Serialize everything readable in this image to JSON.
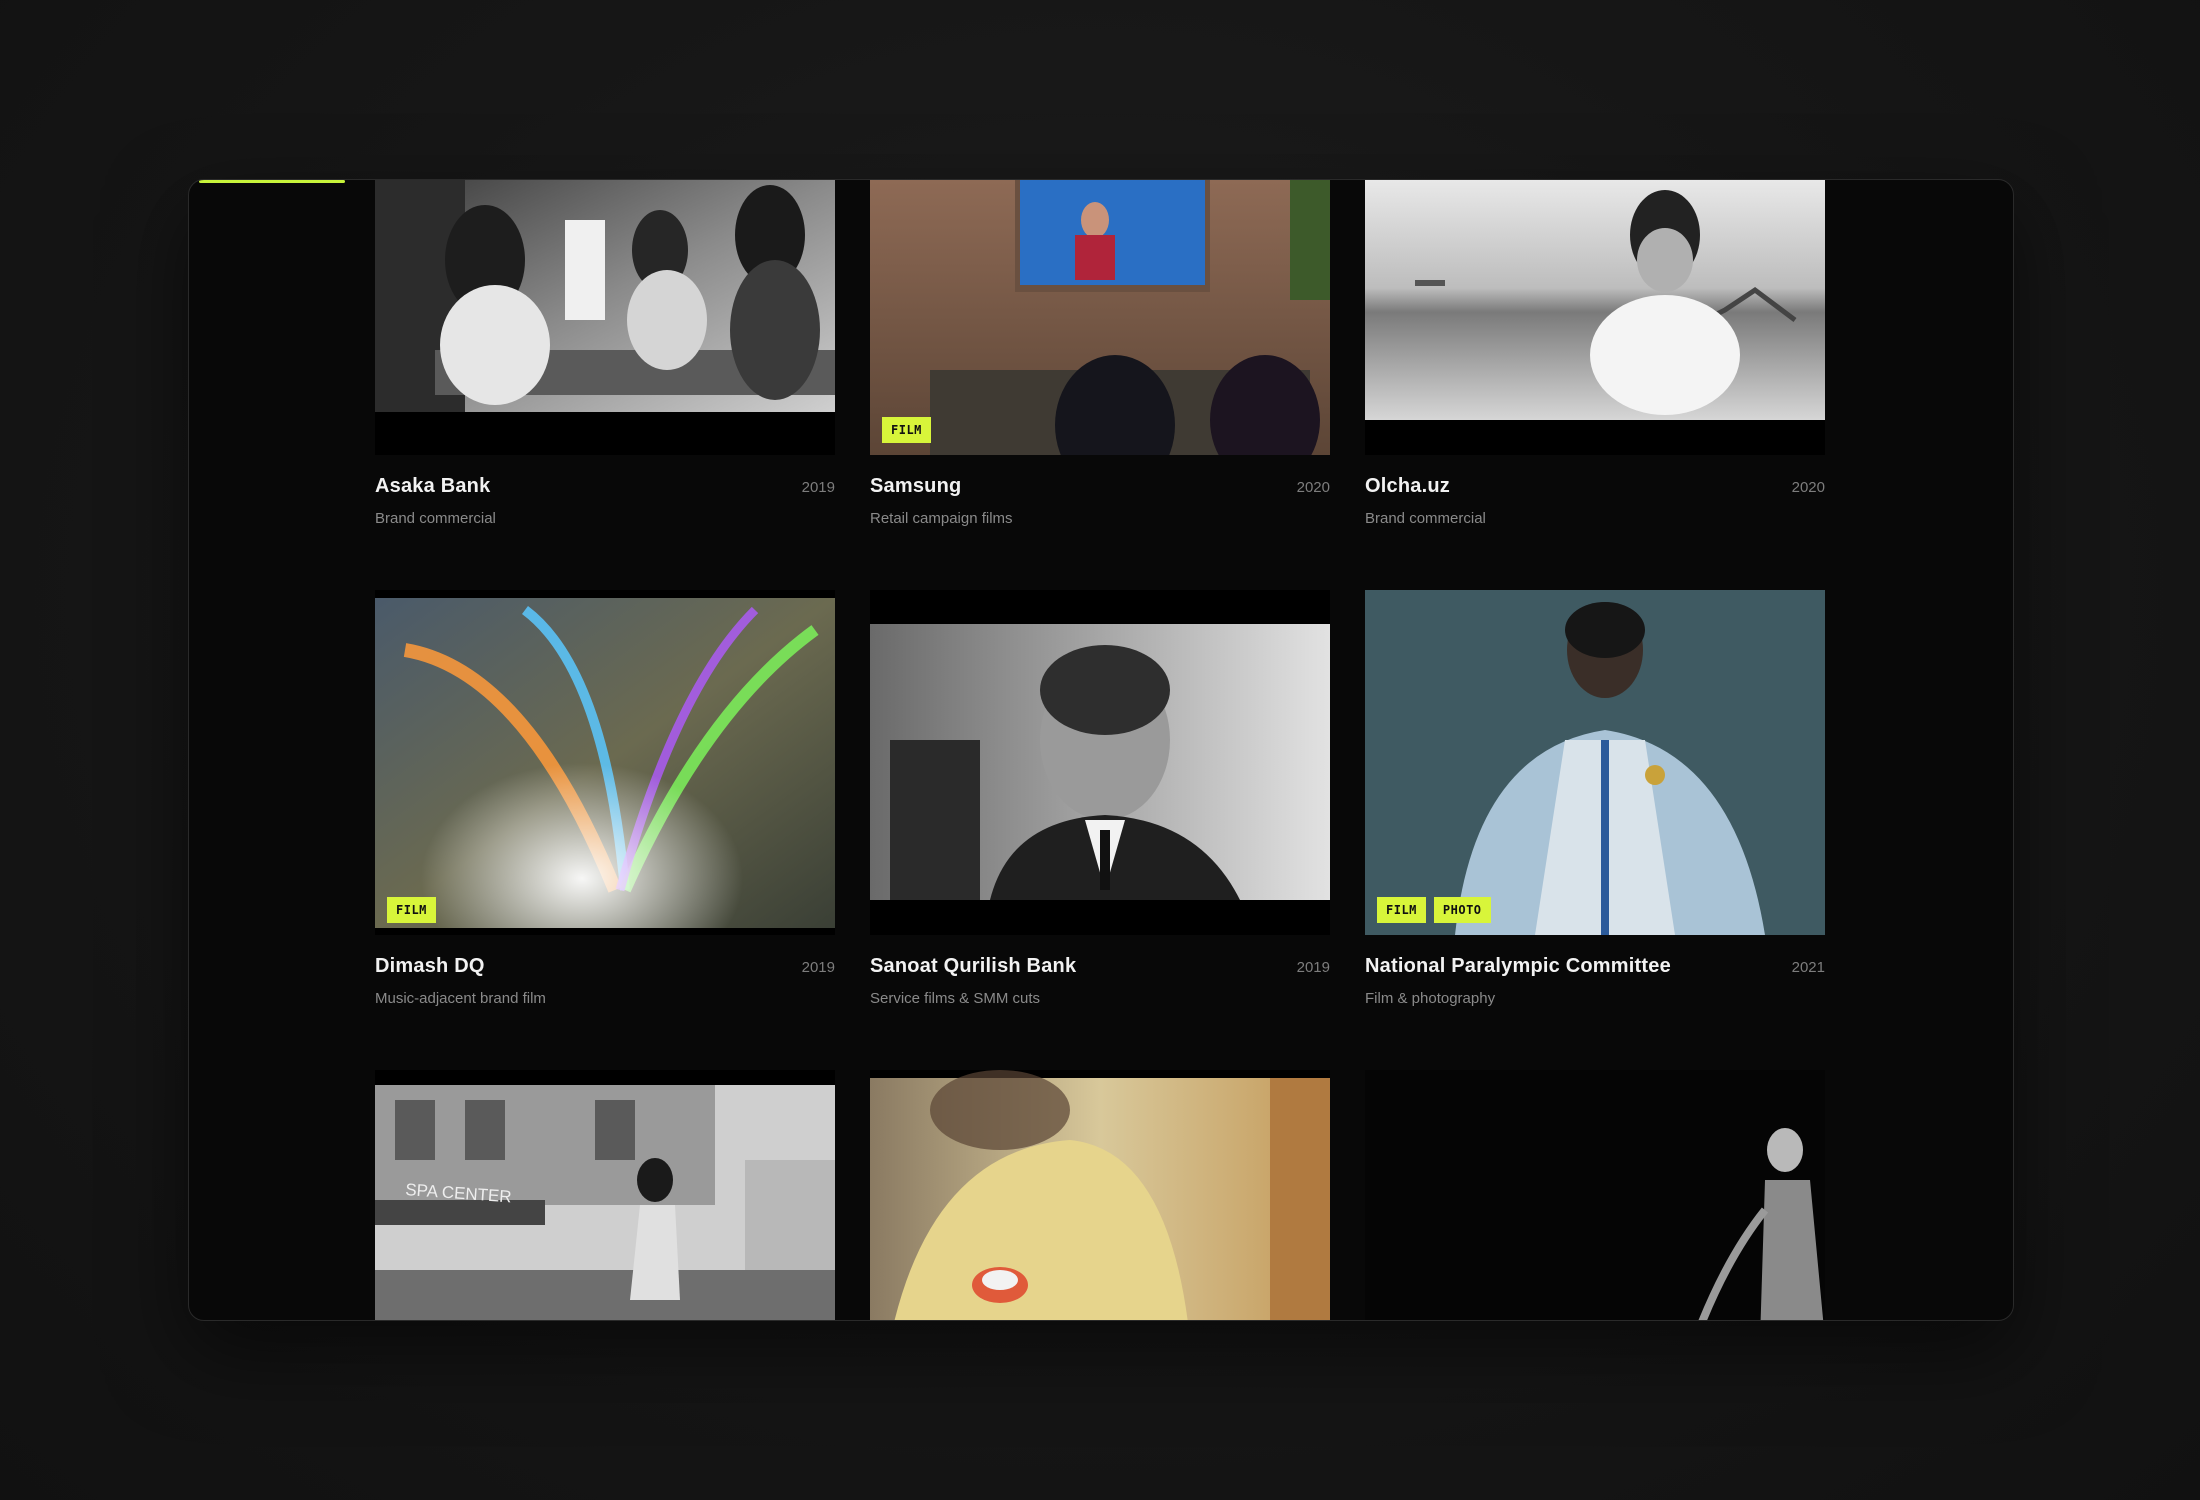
{
  "viewer": {
    "progress_fraction": 0.08
  },
  "projects": [
    {
      "title": "Asaka Bank",
      "year": "2019",
      "subtitle": "Brand commercial",
      "tags": []
    },
    {
      "title": "Samsung",
      "year": "2020",
      "subtitle": "Retail campaign films",
      "tags": [
        "FILM"
      ]
    },
    {
      "title": "Olcha.uz",
      "year": "2020",
      "subtitle": "Brand commercial",
      "tags": []
    },
    {
      "title": "Dimash DQ",
      "year": "2019",
      "subtitle": "Music-adjacent brand film",
      "tags": [
        "FILM"
      ]
    },
    {
      "title": "Sanoat Qurilish Bank",
      "year": "2019",
      "subtitle": "Service films & SMM cuts",
      "tags": []
    },
    {
      "title": "National Paralympic Committee",
      "year": "2021",
      "subtitle": "Film & photography",
      "tags": [
        "FILM",
        "PHOTO"
      ]
    }
  ],
  "partial_row": {
    "thumb_1_sign": "SPA CENTER"
  },
  "colors": {
    "accent": "#d8f53a",
    "frame_bg": "#080808"
  }
}
